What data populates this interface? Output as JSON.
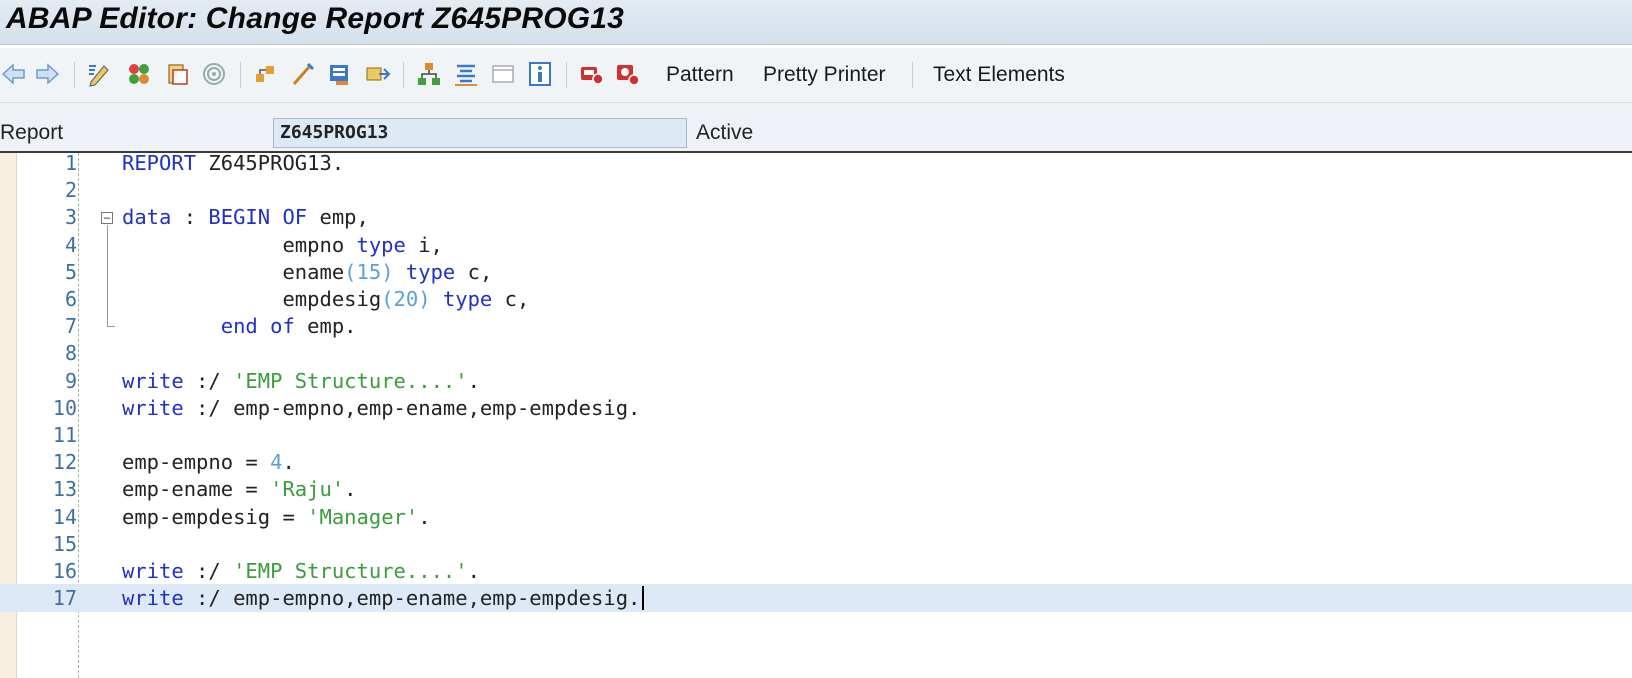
{
  "window": {
    "title": "ABAP Editor: Change Report Z645PROG13"
  },
  "toolbar": {
    "icons": [
      "back-arrow-icon",
      "forward-arrow-icon",
      "display-change-icon",
      "activate-icon",
      "other-object-icon",
      "check-icon",
      "where-used-icon",
      "object-list-icon",
      "navigation-icon",
      "test-icon",
      "hierarchy-icon",
      "list-icon",
      "fullscreen-icon",
      "info-icon",
      "breakpoint-icon",
      "session-breakpoint-icon"
    ],
    "pattern_label": "Pattern",
    "pretty_printer_label": "Pretty Printer",
    "text_elements_label": "Text Elements"
  },
  "info": {
    "report_label": "Report",
    "program_name": "Z645PROG13",
    "status": "Active"
  },
  "editor": {
    "lines": [
      {
        "no": "1",
        "tokens": [
          {
            "t": "REPORT",
            "c": "kw"
          },
          {
            "t": " Z645PROG13.",
            "c": ""
          }
        ]
      },
      {
        "no": "2",
        "tokens": []
      },
      {
        "no": "3",
        "tokens": [
          {
            "t": "data",
            "c": "kw"
          },
          {
            "t": " : ",
            "c": ""
          },
          {
            "t": "BEGIN OF",
            "c": "kw"
          },
          {
            "t": " emp,",
            "c": ""
          }
        ]
      },
      {
        "no": "4",
        "tokens": [
          {
            "t": "             empno ",
            "c": ""
          },
          {
            "t": "type",
            "c": "kw"
          },
          {
            "t": " i,",
            "c": ""
          }
        ]
      },
      {
        "no": "5",
        "tokens": [
          {
            "t": "             ename",
            "c": ""
          },
          {
            "t": "(15)",
            "c": "num"
          },
          {
            "t": " ",
            "c": ""
          },
          {
            "t": "type",
            "c": "kw"
          },
          {
            "t": " c,",
            "c": ""
          }
        ]
      },
      {
        "no": "6",
        "tokens": [
          {
            "t": "             empdesig",
            "c": ""
          },
          {
            "t": "(20)",
            "c": "num"
          },
          {
            "t": " ",
            "c": ""
          },
          {
            "t": "type",
            "c": "kw"
          },
          {
            "t": " c,",
            "c": ""
          }
        ]
      },
      {
        "no": "7",
        "tokens": [
          {
            "t": "        ",
            "c": ""
          },
          {
            "t": "end of",
            "c": "kw"
          },
          {
            "t": " emp.",
            "c": ""
          }
        ]
      },
      {
        "no": "8",
        "tokens": []
      },
      {
        "no": "9",
        "tokens": [
          {
            "t": "write",
            "c": "kw"
          },
          {
            "t": " :/ ",
            "c": ""
          },
          {
            "t": "'EMP Structure....'",
            "c": "str"
          },
          {
            "t": ".",
            "c": ""
          }
        ]
      },
      {
        "no": "10",
        "tokens": [
          {
            "t": "write",
            "c": "kw"
          },
          {
            "t": " :/ emp-empno,emp-ename,emp-empdesig.",
            "c": ""
          }
        ]
      },
      {
        "no": "11",
        "tokens": []
      },
      {
        "no": "12",
        "tokens": [
          {
            "t": "emp-empno = ",
            "c": ""
          },
          {
            "t": "4",
            "c": "num"
          },
          {
            "t": ".",
            "c": ""
          }
        ]
      },
      {
        "no": "13",
        "tokens": [
          {
            "t": "emp-ename = ",
            "c": ""
          },
          {
            "t": "'Raju'",
            "c": "str"
          },
          {
            "t": ".",
            "c": ""
          }
        ]
      },
      {
        "no": "14",
        "tokens": [
          {
            "t": "emp-empdesig = ",
            "c": ""
          },
          {
            "t": "'Manager'",
            "c": "str"
          },
          {
            "t": ".",
            "c": ""
          }
        ]
      },
      {
        "no": "15",
        "tokens": []
      },
      {
        "no": "16",
        "tokens": [
          {
            "t": "write",
            "c": "kw"
          },
          {
            "t": " :/ ",
            "c": ""
          },
          {
            "t": "'EMP Structure....'",
            "c": "str"
          },
          {
            "t": ".",
            "c": ""
          }
        ]
      },
      {
        "no": "17",
        "tokens": [
          {
            "t": "write",
            "c": "kw"
          },
          {
            "t": " :/ emp-empno,emp-ename,emp-empdesig.",
            "c": ""
          }
        ],
        "current": true
      }
    ]
  }
}
